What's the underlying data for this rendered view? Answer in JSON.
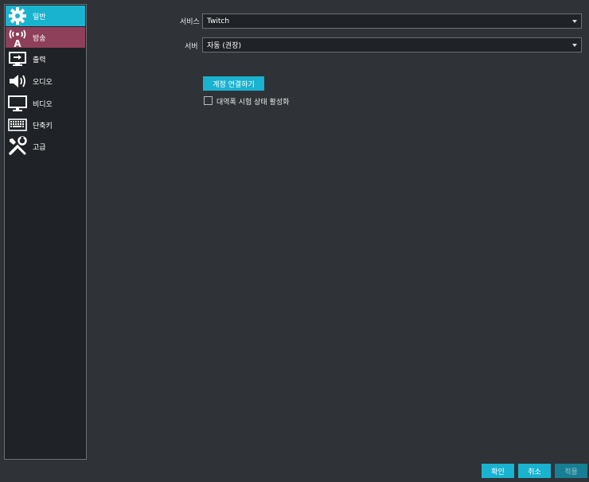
{
  "sidebar": {
    "items": [
      {
        "label": "일반",
        "icon": "gear-icon"
      },
      {
        "label": "방송",
        "icon": "broadcast-icon"
      },
      {
        "label": "출력",
        "icon": "output-icon"
      },
      {
        "label": "오디오",
        "icon": "speaker-icon"
      },
      {
        "label": "비디오",
        "icon": "monitor-icon"
      },
      {
        "label": "단축키",
        "icon": "keyboard-icon"
      },
      {
        "label": "고급",
        "icon": "tools-icon"
      }
    ]
  },
  "stream": {
    "service_label": "서비스",
    "service_value": "Twitch",
    "server_label": "서버",
    "server_value": "자동 (권장)",
    "connect_button": "계정 연결하기",
    "bandwidth_test_label": "대역폭 시험 상태 활성화"
  },
  "footer": {
    "ok": "확인",
    "cancel": "취소",
    "apply": "적용"
  },
  "colors": {
    "accent": "#19b3d0",
    "hover": "#8e3f5a",
    "background": "#2f3337"
  }
}
